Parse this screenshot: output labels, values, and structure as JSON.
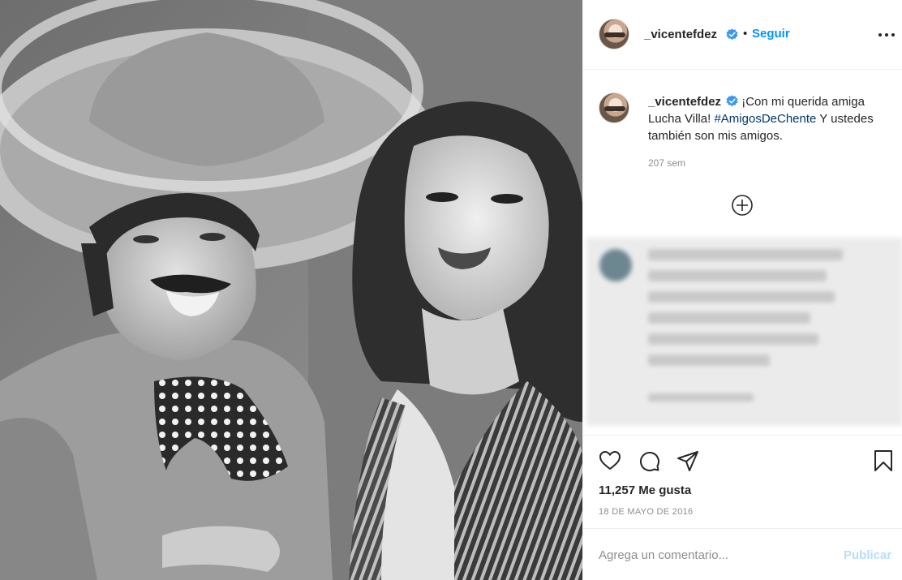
{
  "post": {
    "image_alt": "Black and white photo of a man in a sombrero with a polka-dot bow tie next to a smiling woman",
    "header": {
      "username": "_vicentefdez",
      "separator": "•",
      "follow_label": "Seguir"
    },
    "caption": {
      "username": "_vicentefdez",
      "text_before": " ¡Con mi querida amiga Lucha Villa! ",
      "hashtag": "#AmigosDeChente",
      "text_after": " Y ustedes también son mis amigos.",
      "time_ago": "207 sem"
    },
    "likes_text": "11,257 Me gusta",
    "date": "18 DE MAYO DE 2016",
    "comment": {
      "placeholder": "Agrega un comentario...",
      "publish_label": "Publicar"
    },
    "icons": {
      "verified": "verified-badge-icon",
      "more": "more-options-icon",
      "load_more": "plus-circle-icon",
      "like": "heart-icon",
      "comment": "comment-bubble-icon",
      "share": "paper-plane-icon",
      "save": "bookmark-icon"
    },
    "colors": {
      "link_blue": "#0095f6",
      "hashtag": "#00376b",
      "muted": "#8e8e8e",
      "publish_disabled": "#b2dffc",
      "verified": "#3897f0"
    }
  }
}
